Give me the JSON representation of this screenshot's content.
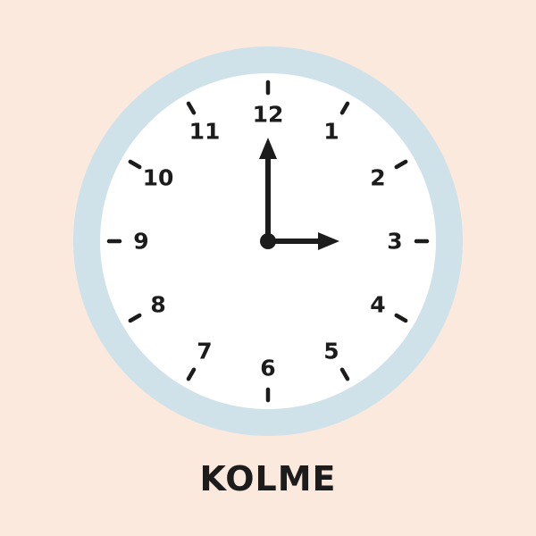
{
  "colors": {
    "background": "#fae9dc",
    "rim": "#cfe2ea",
    "face": "#ffffff",
    "ink": "#1c1c1c"
  },
  "clock": {
    "numerals": [
      "12",
      "1",
      "2",
      "3",
      "4",
      "5",
      "6",
      "7",
      "8",
      "9",
      "10",
      "11"
    ],
    "time": {
      "hours": 3,
      "minutes": 0
    }
  },
  "caption": "KOLME"
}
